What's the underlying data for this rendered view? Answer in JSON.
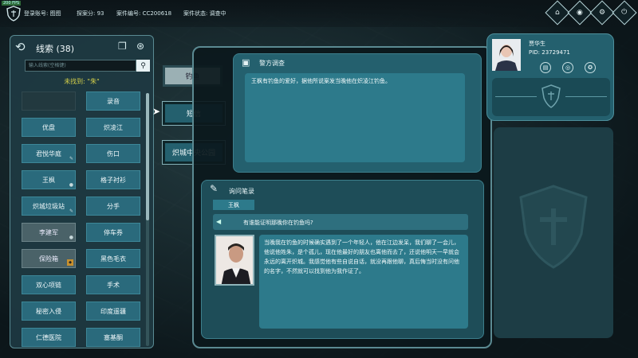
{
  "topbar": {
    "fps": "200 FPS",
    "login_label": "登录账号: 图图",
    "case_count_label": "探案分: 93",
    "case_number_label": "案件编号: CC200618",
    "case_status_label": "案件状态: 调查中",
    "buttons": [
      "home-icon",
      "eye-icon",
      "settings-icon",
      "power-icon"
    ]
  },
  "clues": {
    "title": "线索 (38)",
    "search_placeholder": "输入线索(空格键)",
    "not_found": "未找到: \"朱\"",
    "items": [
      {
        "label": "",
        "style": "empty",
        "mark": ""
      },
      {
        "label": "录音",
        "style": "normal",
        "mark": ""
      },
      {
        "label": "优盘",
        "style": "normal",
        "mark": ""
      },
      {
        "label": "炽凌江",
        "style": "normal",
        "mark": ""
      },
      {
        "label": "君悦华庭",
        "style": "normal",
        "mark": "✎"
      },
      {
        "label": "伤口",
        "style": "normal",
        "mark": ""
      },
      {
        "label": "王枫",
        "style": "normal",
        "mark": "●"
      },
      {
        "label": "格子衬衫",
        "style": "normal",
        "mark": ""
      },
      {
        "label": "炽城垃圾站",
        "style": "normal",
        "mark": "✎"
      },
      {
        "label": "分手",
        "style": "normal",
        "mark": ""
      },
      {
        "label": "李建军",
        "style": "dim",
        "mark": "●"
      },
      {
        "label": "停车券",
        "style": "normal",
        "mark": ""
      },
      {
        "label": "保险箱",
        "style": "dim",
        "mark": "badge"
      },
      {
        "label": "黑色毛衣",
        "style": "normal",
        "mark": ""
      },
      {
        "label": "双心项链",
        "style": "normal",
        "mark": ""
      },
      {
        "label": "手术",
        "style": "normal",
        "mark": ""
      },
      {
        "label": "秘密入侵",
        "style": "normal",
        "mark": ""
      },
      {
        "label": "印度遥疆",
        "style": "normal",
        "mark": ""
      },
      {
        "label": "仁德医院",
        "style": "normal",
        "mark": ""
      },
      {
        "label": "塞基酮",
        "style": "normal",
        "mark": ""
      }
    ]
  },
  "topics": [
    {
      "label": "钓鱼",
      "selected": true
    },
    {
      "label": "短信",
      "selected": false
    },
    {
      "label": "炽城中央公园",
      "selected": false
    }
  ],
  "police": {
    "title": "警方调查",
    "text": "王枫有钓鱼的爱好，据他所说案发当晚他在炽凌江钓鱼。"
  },
  "inquiry": {
    "title": "询问笔录",
    "suspect_name": "王枫",
    "question": "有谁能证明那晚你在钓鱼吗?",
    "answer": "当晚我在钓鱼的时候确实遇到了一个年轻人，他在江边发呆，我们聊了一会儿，他说他姓朱，是个孤儿，现在他最好的朋友也离他而去了，还说他明天一早就会永远的离开炽城。我感觉他有些自说自话，就没再跟他聊，真后悔当时没有问他的名字，不然就可以找到他为我作证了。"
  },
  "profile": {
    "name": "贾华生",
    "pid": "PID:  23729471",
    "actions": [
      "archive-icon",
      "fingerprint-icon",
      "badge-icon"
    ]
  }
}
